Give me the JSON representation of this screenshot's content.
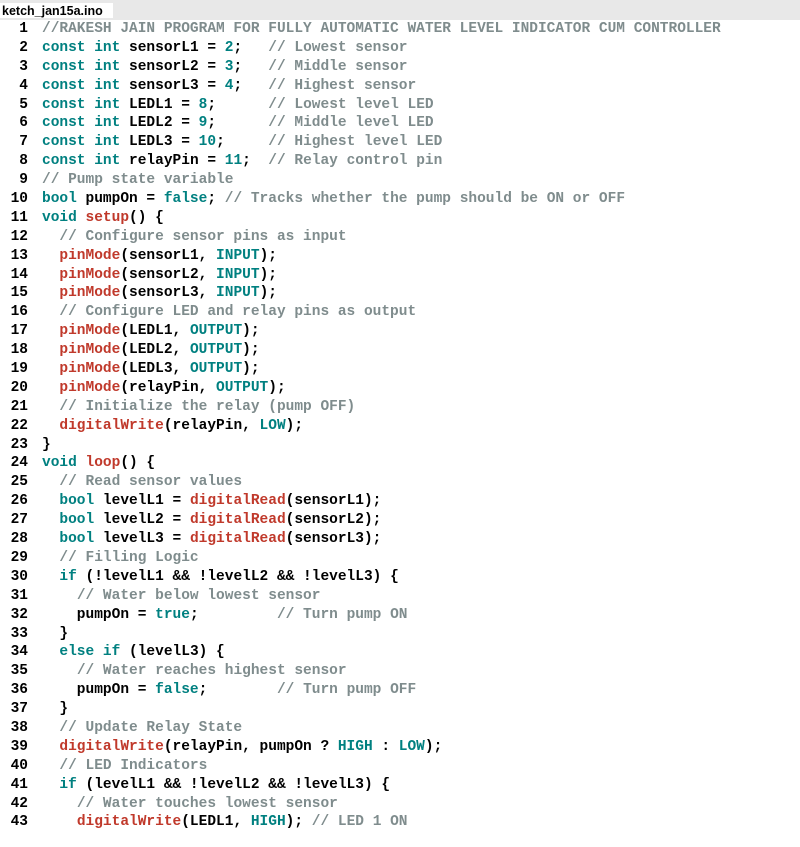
{
  "tab": {
    "filename": "ketch_jan15a.ino"
  },
  "lines": [
    {
      "n": 1,
      "tokens": [
        [
          "cm",
          "//RAKESH JAIN PROGRAM FOR FULLY AUTOMATIC WATER LEVEL INDICATOR CUM CONTROLLER"
        ]
      ]
    },
    {
      "n": 2,
      "tokens": [
        [
          "kw",
          "const int"
        ],
        [
          "pl",
          " sensorL1 = "
        ],
        [
          "kw",
          "2"
        ],
        [
          "pl",
          ";   "
        ],
        [
          "cm",
          "// Lowest sensor"
        ]
      ]
    },
    {
      "n": 3,
      "tokens": [
        [
          "kw",
          "const int"
        ],
        [
          "pl",
          " sensorL2 = "
        ],
        [
          "kw",
          "3"
        ],
        [
          "pl",
          ";   "
        ],
        [
          "cm",
          "// Middle sensor"
        ]
      ]
    },
    {
      "n": 4,
      "tokens": [
        [
          "kw",
          "const int"
        ],
        [
          "pl",
          " sensorL3 = "
        ],
        [
          "kw",
          "4"
        ],
        [
          "pl",
          ";   "
        ],
        [
          "cm",
          "// Highest sensor"
        ]
      ]
    },
    {
      "n": 5,
      "tokens": [
        [
          "kw",
          "const int"
        ],
        [
          "pl",
          " LEDL1 = "
        ],
        [
          "kw",
          "8"
        ],
        [
          "pl",
          ";      "
        ],
        [
          "cm",
          "// Lowest level LED"
        ]
      ]
    },
    {
      "n": 6,
      "tokens": [
        [
          "kw",
          "const int"
        ],
        [
          "pl",
          " LEDL2 = "
        ],
        [
          "kw",
          "9"
        ],
        [
          "pl",
          ";      "
        ],
        [
          "cm",
          "// Middle level LED"
        ]
      ]
    },
    {
      "n": 7,
      "tokens": [
        [
          "kw",
          "const int"
        ],
        [
          "pl",
          " LEDL3 = "
        ],
        [
          "kw",
          "10"
        ],
        [
          "pl",
          ";     "
        ],
        [
          "cm",
          "// Highest level LED"
        ]
      ]
    },
    {
      "n": 8,
      "tokens": [
        [
          "kw",
          "const int"
        ],
        [
          "pl",
          " relayPin = "
        ],
        [
          "kw",
          "11"
        ],
        [
          "pl",
          ";  "
        ],
        [
          "cm",
          "// Relay control pin"
        ]
      ]
    },
    {
      "n": 9,
      "tokens": [
        [
          "cm",
          "// Pump state variable"
        ]
      ]
    },
    {
      "n": 10,
      "tokens": [
        [
          "kw",
          "bool"
        ],
        [
          "pl",
          " pumpOn = "
        ],
        [
          "kw",
          "false"
        ],
        [
          "pl",
          "; "
        ],
        [
          "cm",
          "// Tracks whether the pump should be ON or OFF"
        ]
      ]
    },
    {
      "n": 11,
      "tokens": [
        [
          "kw",
          "void"
        ],
        [
          "pl",
          " "
        ],
        [
          "fn",
          "setup"
        ],
        [
          "pl",
          "() {"
        ]
      ]
    },
    {
      "n": 12,
      "tokens": [
        [
          "pl",
          "  "
        ],
        [
          "cm",
          "// Configure sensor pins as input"
        ]
      ]
    },
    {
      "n": 13,
      "tokens": [
        [
          "pl",
          "  "
        ],
        [
          "fn",
          "pinMode"
        ],
        [
          "pl",
          "(sensorL1, "
        ],
        [
          "kw",
          "INPUT"
        ],
        [
          "pl",
          ");"
        ]
      ]
    },
    {
      "n": 14,
      "tokens": [
        [
          "pl",
          "  "
        ],
        [
          "fn",
          "pinMode"
        ],
        [
          "pl",
          "(sensorL2, "
        ],
        [
          "kw",
          "INPUT"
        ],
        [
          "pl",
          ");"
        ]
      ]
    },
    {
      "n": 15,
      "tokens": [
        [
          "pl",
          "  "
        ],
        [
          "fn",
          "pinMode"
        ],
        [
          "pl",
          "(sensorL3, "
        ],
        [
          "kw",
          "INPUT"
        ],
        [
          "pl",
          ");"
        ]
      ]
    },
    {
      "n": 16,
      "tokens": [
        [
          "pl",
          "  "
        ],
        [
          "cm",
          "// Configure LED and relay pins as output"
        ]
      ]
    },
    {
      "n": 17,
      "tokens": [
        [
          "pl",
          "  "
        ],
        [
          "fn",
          "pinMode"
        ],
        [
          "pl",
          "(LEDL1, "
        ],
        [
          "kw",
          "OUTPUT"
        ],
        [
          "pl",
          ");"
        ]
      ]
    },
    {
      "n": 18,
      "tokens": [
        [
          "pl",
          "  "
        ],
        [
          "fn",
          "pinMode"
        ],
        [
          "pl",
          "(LEDL2, "
        ],
        [
          "kw",
          "OUTPUT"
        ],
        [
          "pl",
          ");"
        ]
      ]
    },
    {
      "n": 19,
      "tokens": [
        [
          "pl",
          "  "
        ],
        [
          "fn",
          "pinMode"
        ],
        [
          "pl",
          "(LEDL3, "
        ],
        [
          "kw",
          "OUTPUT"
        ],
        [
          "pl",
          ");"
        ]
      ]
    },
    {
      "n": 20,
      "tokens": [
        [
          "pl",
          "  "
        ],
        [
          "fn",
          "pinMode"
        ],
        [
          "pl",
          "(relayPin, "
        ],
        [
          "kw",
          "OUTPUT"
        ],
        [
          "pl",
          ");"
        ]
      ]
    },
    {
      "n": 21,
      "tokens": [
        [
          "pl",
          "  "
        ],
        [
          "cm",
          "// Initialize the relay (pump OFF)"
        ]
      ]
    },
    {
      "n": 22,
      "tokens": [
        [
          "pl",
          "  "
        ],
        [
          "fn",
          "digitalWrite"
        ],
        [
          "pl",
          "(relayPin, "
        ],
        [
          "kw",
          "LOW"
        ],
        [
          "pl",
          ");"
        ]
      ]
    },
    {
      "n": 23,
      "tokens": [
        [
          "pl",
          "}"
        ]
      ]
    },
    {
      "n": 24,
      "tokens": [
        [
          "kw",
          "void"
        ],
        [
          "pl",
          " "
        ],
        [
          "fn",
          "loop"
        ],
        [
          "pl",
          "() {"
        ]
      ]
    },
    {
      "n": 25,
      "tokens": [
        [
          "pl",
          "  "
        ],
        [
          "cm",
          "// Read sensor values"
        ]
      ]
    },
    {
      "n": 26,
      "tokens": [
        [
          "pl",
          "  "
        ],
        [
          "kw",
          "bool"
        ],
        [
          "pl",
          " levelL1 = "
        ],
        [
          "fn",
          "digitalRead"
        ],
        [
          "pl",
          "(sensorL1);"
        ]
      ]
    },
    {
      "n": 27,
      "tokens": [
        [
          "pl",
          "  "
        ],
        [
          "kw",
          "bool"
        ],
        [
          "pl",
          " levelL2 = "
        ],
        [
          "fn",
          "digitalRead"
        ],
        [
          "pl",
          "(sensorL2);"
        ]
      ]
    },
    {
      "n": 28,
      "tokens": [
        [
          "pl",
          "  "
        ],
        [
          "kw",
          "bool"
        ],
        [
          "pl",
          " levelL3 = "
        ],
        [
          "fn",
          "digitalRead"
        ],
        [
          "pl",
          "(sensorL3);"
        ]
      ]
    },
    {
      "n": 29,
      "tokens": [
        [
          "pl",
          "  "
        ],
        [
          "cm",
          "// Filling Logic"
        ]
      ]
    },
    {
      "n": 30,
      "tokens": [
        [
          "pl",
          "  "
        ],
        [
          "kw",
          "if"
        ],
        [
          "pl",
          " (!levelL1 && !levelL2 && !levelL3) {"
        ]
      ]
    },
    {
      "n": 31,
      "tokens": [
        [
          "pl",
          "    "
        ],
        [
          "cm",
          "// Water below lowest sensor"
        ]
      ]
    },
    {
      "n": 32,
      "tokens": [
        [
          "pl",
          "    pumpOn = "
        ],
        [
          "kw",
          "true"
        ],
        [
          "pl",
          ";         "
        ],
        [
          "cm",
          "// Turn pump ON"
        ]
      ]
    },
    {
      "n": 33,
      "tokens": [
        [
          "pl",
          "  }"
        ]
      ]
    },
    {
      "n": 34,
      "tokens": [
        [
          "pl",
          "  "
        ],
        [
          "kw",
          "else if"
        ],
        [
          "pl",
          " (levelL3) {"
        ]
      ]
    },
    {
      "n": 35,
      "tokens": [
        [
          "pl",
          "    "
        ],
        [
          "cm",
          "// Water reaches highest sensor"
        ]
      ]
    },
    {
      "n": 36,
      "tokens": [
        [
          "pl",
          "    pumpOn = "
        ],
        [
          "kw",
          "false"
        ],
        [
          "pl",
          ";        "
        ],
        [
          "cm",
          "// Turn pump OFF"
        ]
      ]
    },
    {
      "n": 37,
      "tokens": [
        [
          "pl",
          "  }"
        ]
      ]
    },
    {
      "n": 38,
      "tokens": [
        [
          "pl",
          "  "
        ],
        [
          "cm",
          "// Update Relay State"
        ]
      ]
    },
    {
      "n": 39,
      "tokens": [
        [
          "pl",
          "  "
        ],
        [
          "fn",
          "digitalWrite"
        ],
        [
          "pl",
          "(relayPin, pumpOn ? "
        ],
        [
          "kw",
          "HIGH"
        ],
        [
          "pl",
          " : "
        ],
        [
          "kw",
          "LOW"
        ],
        [
          "pl",
          ");"
        ]
      ]
    },
    {
      "n": 40,
      "tokens": [
        [
          "pl",
          "  "
        ],
        [
          "cm",
          "// LED Indicators"
        ]
      ]
    },
    {
      "n": 41,
      "tokens": [
        [
          "pl",
          "  "
        ],
        [
          "kw",
          "if"
        ],
        [
          "pl",
          " (levelL1 && !levelL2 && !levelL3) {"
        ]
      ]
    },
    {
      "n": 42,
      "tokens": [
        [
          "pl",
          "    "
        ],
        [
          "cm",
          "// Water touches lowest sensor"
        ]
      ]
    },
    {
      "n": 43,
      "tokens": [
        [
          "pl",
          "    "
        ],
        [
          "fn",
          "digitalWrite"
        ],
        [
          "pl",
          "(LEDL1, "
        ],
        [
          "kw",
          "HIGH"
        ],
        [
          "pl",
          "); "
        ],
        [
          "cm",
          "// LED 1 ON"
        ]
      ]
    }
  ]
}
